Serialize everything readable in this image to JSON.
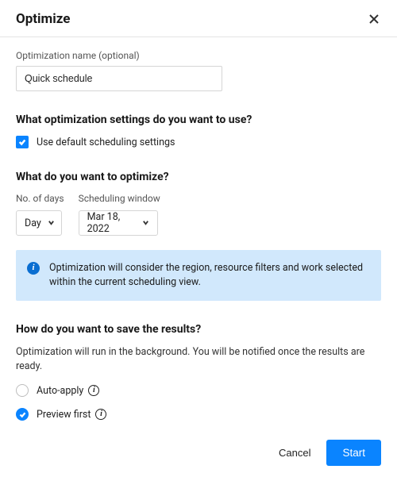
{
  "header": {
    "title": "Optimize"
  },
  "name_field": {
    "label": "Optimization name (optional)",
    "value": "Quick schedule"
  },
  "sections": {
    "settings_heading": "What optimization settings do you want to use?",
    "settings_checkbox_label": "Use default scheduling settings",
    "optimize_heading": "What do you want to optimize?",
    "days_label": "No. of days",
    "days_value": "Day",
    "window_label": "Scheduling window",
    "window_value": "Mar 18, 2022",
    "info_text": "Optimization will consider the region, resource filters and work selected within the current scheduling view.",
    "save_heading": "How do you want to save the results?",
    "save_sub": "Optimization will run in the background. You will be notified once the results are ready.",
    "radio_auto": "Auto-apply",
    "radio_preview": "Preview first"
  },
  "footer": {
    "cancel": "Cancel",
    "start": "Start"
  }
}
